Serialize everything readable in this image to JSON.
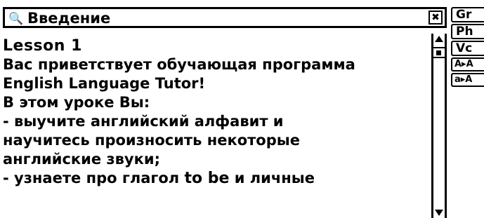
{
  "window": {
    "title": "Введение",
    "title_icon": "binoculars-icon",
    "close_icon": "close-icon",
    "close_glyph": "✖"
  },
  "content": {
    "lines": [
      "Lesson 1",
      "Вас приветствует обучающая программа",
      "English Language Tutor!",
      "В этом уроке Вы:",
      "- выучите английский алфавит и",
      "научитесь произносить некоторые",
      "английские звуки;",
      "- узнаете про глагол to be и личные"
    ],
    "highlight": "to be"
  },
  "scrollbar": {
    "up_icon": "scroll-up-arrow-icon",
    "thumb_icon": "scroll-thumb-icon",
    "down_icon": "scroll-down-arrow-icon"
  },
  "side_buttons": [
    {
      "label": "Gr"
    },
    {
      "label": "Ph"
    },
    {
      "label": "Vc"
    },
    {
      "label": "A▸A"
    },
    {
      "label": "a▸A"
    }
  ]
}
